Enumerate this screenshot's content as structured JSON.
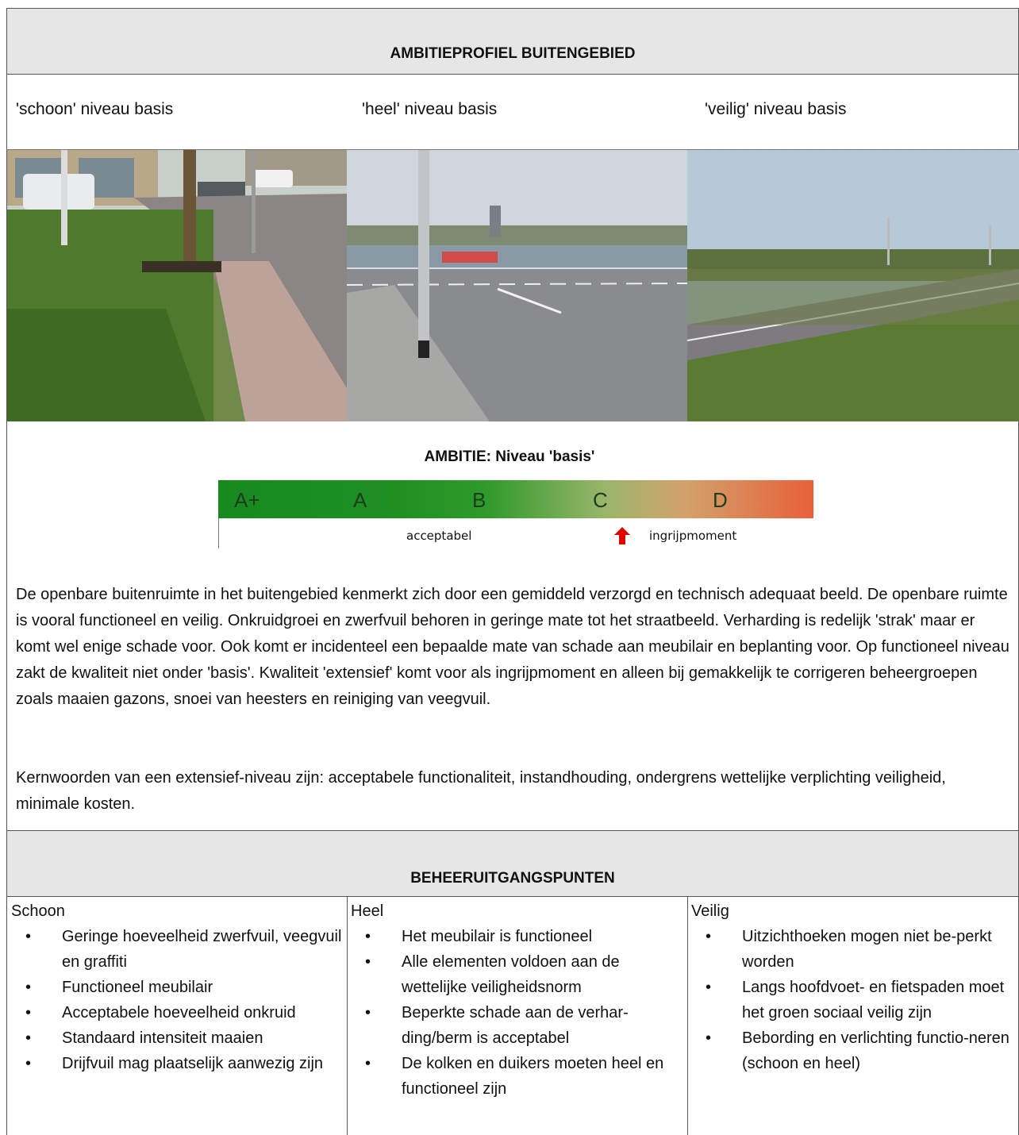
{
  "section1": {
    "title": "AMBITIEPROFIEL BUITENGEBIED",
    "labels": [
      "'schoon' niveau basis",
      "'heel' niveau basis",
      "'veilig' niveau basis"
    ]
  },
  "photos": [
    {
      "name": "Photo of pavement and street with parked van",
      "alt": "schoon"
    },
    {
      "name": "Photo of crossing with lamp post",
      "alt": "heel"
    },
    {
      "name": "Photo of rural road with street lights",
      "alt": "veilig"
    }
  ],
  "ambition": {
    "title": "AMBITIE: Niveau 'basis'",
    "grades": [
      "A+",
      "A",
      "B",
      "C",
      "D"
    ],
    "label_acceptable": "acceptabel",
    "label_intervention": "ingrijpmoment",
    "colors": {
      "green": "#178a1f",
      "orange": "#e8603a",
      "arrow": "#e00000"
    }
  },
  "paragraph1": "De openbare buitenruimte in het buitengebied kenmerkt zich door een gemiddeld verzorgd en technisch adequaat beeld. De openbare ruimte is vooral functioneel en veilig. Onkruidgroei en zwerfvuil behoren in geringe mate tot het straatbeeld. Verharding is redelijk 'strak' maar er komt wel enige schade voor. Ook komt er incidenteel een bepaalde mate van schade aan meubilair en beplanting voor. Op functioneel niveau zakt de kwaliteit niet onder 'basis'. Kwaliteit 'extensief' komt voor als ingrijpmoment en alleen bij gemakkelijk te corrigeren beheergroepen zoals maaien gazons, snoei van heesters en reiniging van veegvuil.",
  "paragraph2": "Kernwoorden van een extensief-niveau zijn: acceptabele functionaliteit, instandhouding, ondergrens wettelijke verplichting veiligheid, minimale kosten.",
  "section2": {
    "title": "BEHEERUITGANGSPUNTEN",
    "columns": [
      {
        "title": "Schoon",
        "items": [
          "Geringe hoeveelheid zwerfvuil, veegvuil en graffiti",
          "Functioneel meubilair",
          "Acceptabele hoeveelheid onkruid",
          "Standaard intensiteit maaien",
          "Drijfvuil mag plaatselijk aanwezig zijn"
        ]
      },
      {
        "title": "Heel",
        "items": [
          "Het meubilair is functioneel",
          "Alle elementen voldoen aan de wettelijke veiligheidsnorm",
          "Beperkte schade aan de verhar-ding/berm is acceptabel",
          "De kolken en duikers moeten heel en functioneel zijn"
        ]
      },
      {
        "title": "Veilig",
        "items": [
          "Uitzichthoeken mogen niet be-perkt worden",
          "Langs hoofdvoet- en fietspaden moet het groen sociaal veilig zijn",
          "Bebording en verlichting functio-neren (schoon en heel)"
        ]
      }
    ]
  }
}
